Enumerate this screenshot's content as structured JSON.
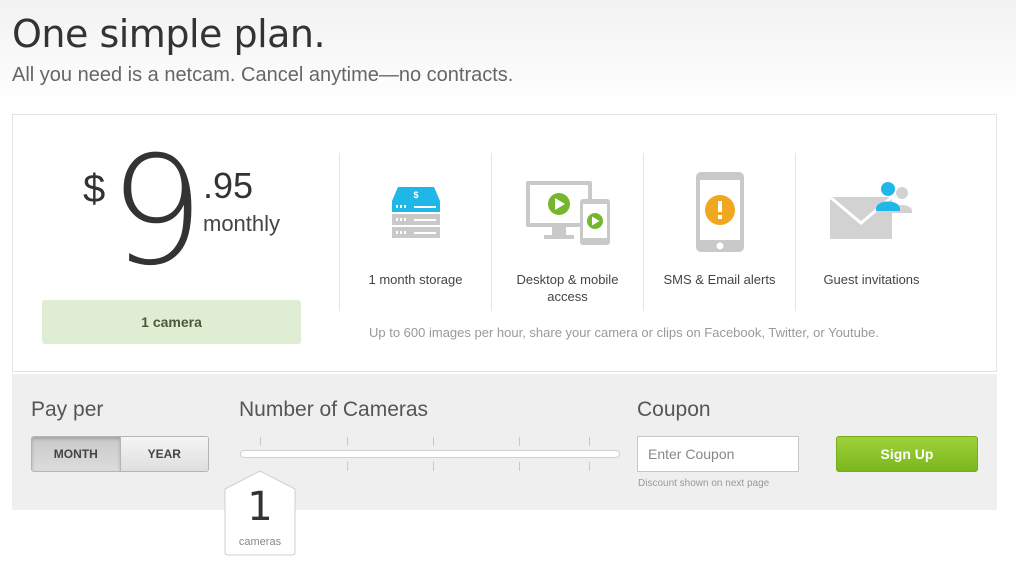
{
  "header": {
    "title": "One simple plan.",
    "subtitle": "All you need is a netcam. Cancel anytime—no contracts."
  },
  "price": {
    "currency": "$",
    "dollars": "9",
    "cents": ".95",
    "period": "monthly",
    "camera_badge": "1 camera"
  },
  "features": [
    {
      "icon": "server-storage-icon",
      "label": "1 month storage"
    },
    {
      "icon": "desktop-mobile-icon",
      "label": "Desktop & mobile access"
    },
    {
      "icon": "phone-alert-icon",
      "label": "SMS & Email alerts"
    },
    {
      "icon": "guest-invite-icon",
      "label": "Guest invitations"
    }
  ],
  "footnote": "Up to 600 images per hour, share your camera or clips on Facebook, Twitter, or Youtube.",
  "controls": {
    "pay_per_label": "Pay per",
    "pay_options": [
      "MONTH",
      "YEAR"
    ],
    "selected_option": "MONTH",
    "cameras_label": "Number of Cameras",
    "camera_count": "1",
    "camera_unit": "cameras",
    "coupon_label": "Coupon",
    "coupon_placeholder": "Enter Coupon",
    "coupon_note": "Discount shown on next page",
    "signup_label": "Sign Up"
  },
  "colors": {
    "accent_green": "#8cc42a",
    "badge_green": "#dfedd2",
    "icon_blue": "#1fb6e8",
    "alert_orange": "#f0a820"
  }
}
